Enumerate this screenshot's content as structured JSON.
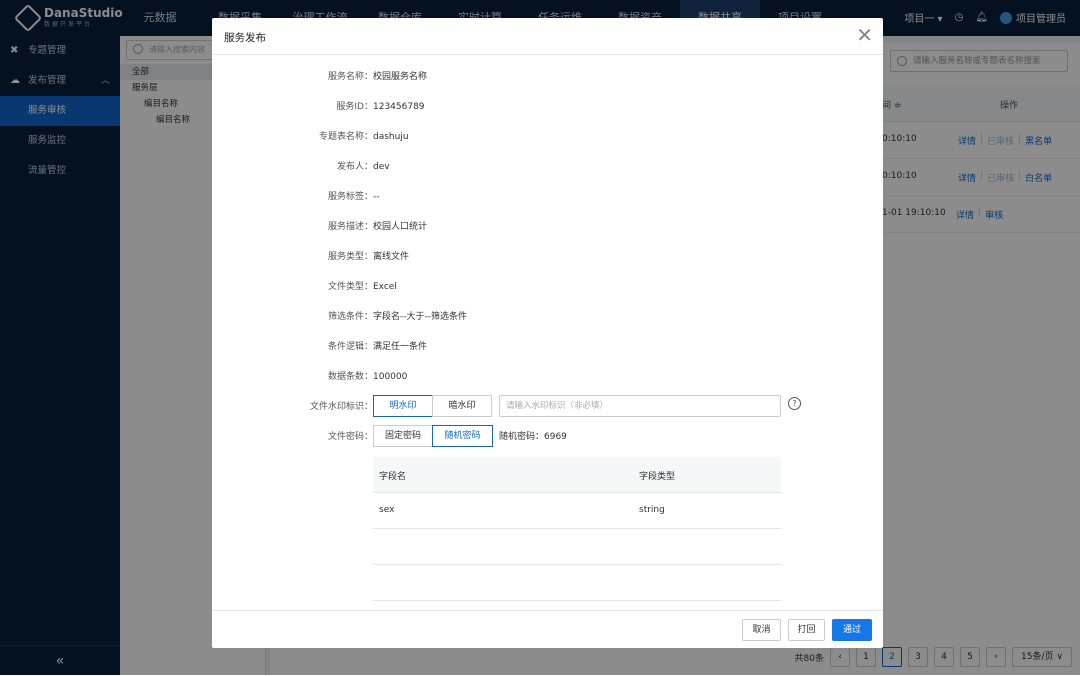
{
  "app": {
    "logo": "DanaStudio",
    "logo_sub": "数据开发平台"
  },
  "nav": [
    "元数据",
    "数据采集",
    "治理工作流",
    "数据仓库",
    "实时计算",
    "任务运维",
    "数据资产",
    "数据共享",
    "项目设置"
  ],
  "nav_active": 7,
  "top_right": {
    "project": "项目一",
    "user": "项目管理员"
  },
  "sidebar": {
    "items": [
      {
        "label": "专题管理",
        "icon": "wrench-icon"
      },
      {
        "label": "发布管理",
        "icon": "cloud-icon"
      },
      {
        "label": "服务审核"
      },
      {
        "label": "服务监控"
      },
      {
        "label": "流量管控"
      }
    ]
  },
  "tree": {
    "search_placeholder": "请输入搜索内容",
    "items": [
      "全部",
      "服务层",
      "编目名称",
      "编目名称"
    ]
  },
  "table": {
    "search_placeholder": "请输入服务名称或专题表名称搜索",
    "col_time": "间 ≑",
    "col_ops": "操作",
    "rows": [
      {
        "time": "0:10:10",
        "ops": [
          "详情",
          "已审核",
          "黑名单"
        ]
      },
      {
        "time": "0:10:10",
        "ops": [
          "详情",
          "已审核",
          "白名单"
        ]
      },
      {
        "time": "1-01 19:10:10",
        "ops": [
          "详情",
          "审核"
        ]
      }
    ]
  },
  "pager": {
    "total": "共80条",
    "pages": [
      "1",
      "2",
      "3",
      "4",
      "5"
    ],
    "current": "2",
    "size": "15条/页"
  },
  "modal": {
    "title": "服务发布",
    "fields": [
      {
        "label": "服务名称：",
        "value": "校园服务名称"
      },
      {
        "label": "服务ID：",
        "value": "123456789"
      },
      {
        "label": "专题表名称：",
        "value": "dashuju"
      },
      {
        "label": "发布人：",
        "value": "dev"
      },
      {
        "label": "服务标签：",
        "value": "--"
      },
      {
        "label": "服务描述：",
        "value": "校园人口统计"
      },
      {
        "label": "服务类型：",
        "value": "离线文件"
      },
      {
        "label": "文件类型：",
        "value": "Excel"
      },
      {
        "label": "筛选条件：",
        "value": "字段名--大于--筛选条件"
      },
      {
        "label": "条件逻辑：",
        "value": "满足任一条件"
      },
      {
        "label": "数据条数：",
        "value": "100000"
      }
    ],
    "watermark": {
      "label": "文件水印标识：",
      "opt_visible": "明水印",
      "opt_hidden": "暗水印",
      "placeholder": "请输入水印标识（非必填）",
      "help": "?"
    },
    "password": {
      "label": "文件密码：",
      "opt_fixed": "固定密码",
      "opt_random": "随机密码",
      "random_text": "随机密码：6969"
    },
    "fields_table": {
      "col_name": "字段名",
      "col_type": "字段类型",
      "rows": [
        {
          "name": "sex",
          "type": "string"
        }
      ]
    },
    "buttons": {
      "cancel": "取消",
      "reject": "打回",
      "approve": "通过"
    }
  }
}
